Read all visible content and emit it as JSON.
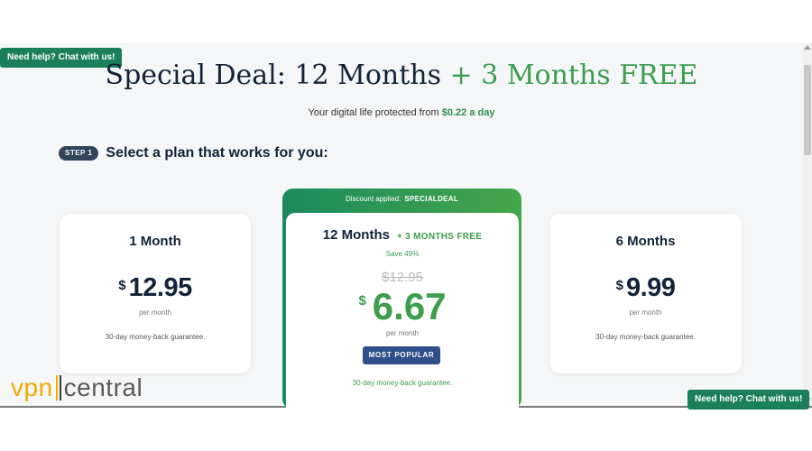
{
  "chat": {
    "label": "Need help? Chat with us!"
  },
  "header": {
    "title_main": "Special Deal: 12 Months",
    "title_free": "+ 3 Months FREE",
    "subtitle_text": "Your digital life protected from",
    "subtitle_price": "$0.22 a day"
  },
  "step": {
    "badge": "STEP 1",
    "text": "Select a plan that works for you:"
  },
  "plans": [
    {
      "name": "1 Month",
      "currency": "$",
      "price": "12.95",
      "per": "per month",
      "guarantee": "30-day money-back guarantee."
    },
    {
      "name": "12 Months",
      "bonus": "+ 3 MONTHS FREE",
      "save": "Save 49%",
      "old_price": "$12.95",
      "currency": "$",
      "price": "6.67",
      "per": "per month",
      "badge": "MOST POPULAR",
      "guarantee": "30-day money-back guarantee.",
      "discount_label": "Discount applied:",
      "discount_code": "SPECIALDEAL"
    },
    {
      "name": "6 Months",
      "currency": "$",
      "price": "9.99",
      "per": "per month",
      "guarantee": "30-day money-back guarantee."
    }
  ],
  "logo": {
    "vpn": "vpn",
    "central": "central"
  },
  "colors": {
    "brand_green": "#3d9e4e",
    "dark_navy": "#12233a",
    "badge_blue": "#2f4f8a",
    "chat_green": "#1a7f5a",
    "logo_orange": "#f2a900"
  }
}
